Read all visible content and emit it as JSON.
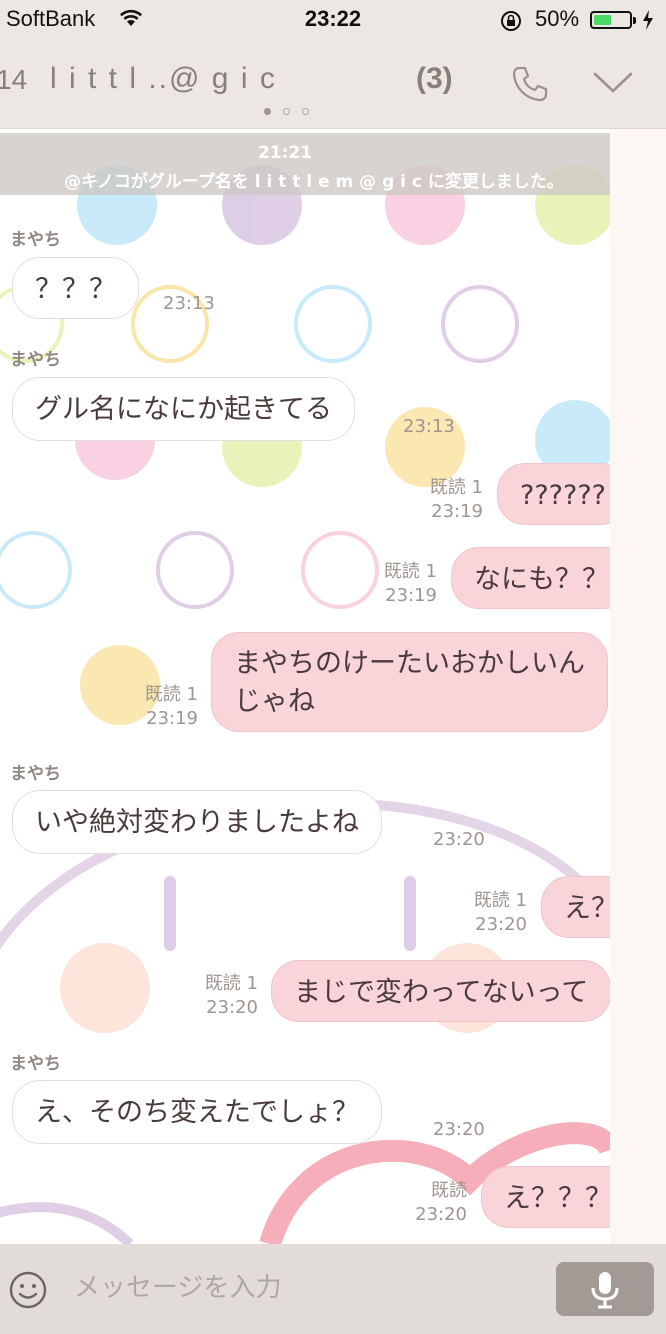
{
  "status_bar": {
    "carrier": "SoftBank",
    "time": "23:22",
    "battery": "50%",
    "battery_level": 0.5
  },
  "header": {
    "back_count": "14",
    "title": "l i t t l ..@ g i c",
    "member_count": "(3)",
    "page_index": 0,
    "page_count": 3
  },
  "system_notice": {
    "time": "21:21",
    "text": "@キノコがグループ名を l i t t l e m @ g i c に変更しました。"
  },
  "messages": [
    {
      "sender": "まやち",
      "text": "？？？",
      "time": "23:13",
      "dir": "in"
    },
    {
      "sender": "まやち",
      "text": "グル名になにか起きてる",
      "time": "23:13",
      "dir": "in"
    },
    {
      "read": "既読 1",
      "text": "??????",
      "time": "23:19",
      "dir": "out"
    },
    {
      "read": "既読 1",
      "text": "なにも？？",
      "time": "23:19",
      "dir": "out"
    },
    {
      "read": "既読 1",
      "text_line1": "まやちのけーたいおかしいん",
      "text_line2": "じゃね",
      "time": "23:19",
      "dir": "out"
    },
    {
      "sender": "まやち",
      "text": "いや絶対変わりましたよね",
      "time": "23:20",
      "dir": "in"
    },
    {
      "read": "既読 1",
      "text": "え？",
      "time": "23:20",
      "dir": "out"
    },
    {
      "read": "既読 1",
      "text": "まじで変わってないって",
      "time": "23:20",
      "dir": "out"
    },
    {
      "sender": "まやち",
      "text": "え、そのち変えたでしょ？",
      "time": "23:20",
      "dir": "in"
    },
    {
      "read": "既読",
      "text": "え？？？",
      "time": "23:20",
      "dir": "out"
    }
  ],
  "composer": {
    "placeholder": "メッセージを入力"
  },
  "icons": {
    "wifi": "wifi-icon",
    "lock": "rotation-lock-icon",
    "phone": "phone-icon",
    "chevron": "chevron-down-icon",
    "emoji": "emoji-icon",
    "mic": "microphone-icon",
    "charge": "charging-icon"
  },
  "colors": {
    "outgoing_bubble": "#f9d4d9",
    "incoming_bubble": "#ffffff",
    "header_bg": "#ece7e2",
    "battery_green": "#4cd964"
  }
}
